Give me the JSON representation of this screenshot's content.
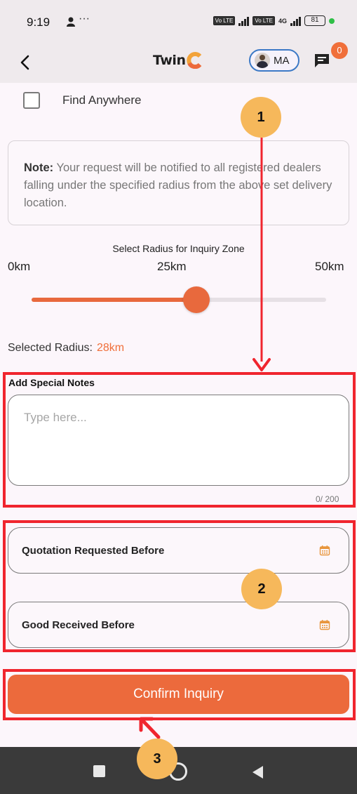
{
  "status_bar": {
    "time": "9:19",
    "dots": "···",
    "battery": "81",
    "network": "4G",
    "volte": "Vo LTE"
  },
  "app_bar": {
    "logo_text": "Twin",
    "user_initials": "MA",
    "chat_badge": "0"
  },
  "find_anywhere": {
    "label": "Find Anywhere",
    "checked": false
  },
  "note": {
    "bold": "Note:",
    "text": " Your request will be notified to all registered dealers falling under the specified radius from the above set delivery location."
  },
  "radius": {
    "title": "Select Radius for Inquiry Zone",
    "min_label": "0km",
    "mid_label": "25km",
    "max_label": "50km",
    "min": 0,
    "max": 50,
    "value": 28,
    "selected_label": "Selected Radius:",
    "selected_value": "28km"
  },
  "special_notes": {
    "title": "Add Special Notes",
    "placeholder": "Type here...",
    "counter": "0/ 200"
  },
  "dates": {
    "quotation_label": "Quotation Requested Before",
    "goods_label": "Good Received Before"
  },
  "confirm_label": "Confirm Inquiry",
  "annotations": {
    "one": "1",
    "two": "2",
    "three": "3"
  },
  "colors": {
    "accent": "#ec6a3c",
    "highlight": "#f0252e",
    "annotation": "#f6b85b"
  }
}
